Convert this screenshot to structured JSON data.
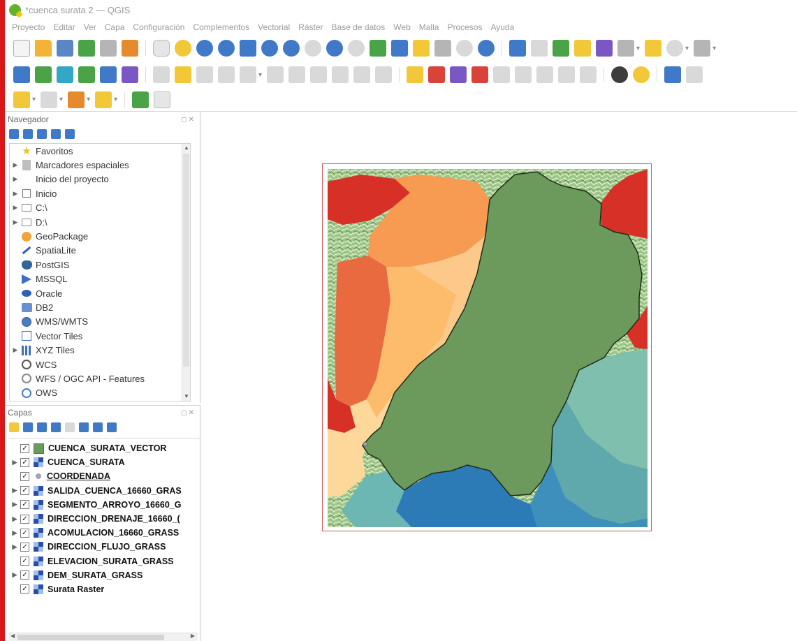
{
  "window": {
    "title": "*cuenca surata 2 — QGIS"
  },
  "menu": [
    "Proyecto",
    "Editar",
    "Ver",
    "Capa",
    "Configuración",
    "Complementos",
    "Vectorial",
    "Ráster",
    "Base de datos",
    "Web",
    "Malla",
    "Procesos",
    "Ayuda"
  ],
  "browser": {
    "title": "Navegador",
    "items": [
      {
        "label": "Favoritos",
        "icon": "star-icon",
        "expandable": false
      },
      {
        "label": "Marcadores espaciales",
        "icon": "bookmark-icon",
        "expandable": true
      },
      {
        "label": "Inicio del proyecto",
        "icon": "project-home-icon",
        "expandable": true
      },
      {
        "label": "Inicio",
        "icon": "home-folder-icon",
        "expandable": true
      },
      {
        "label": "C:\\",
        "icon": "drive-icon",
        "expandable": true
      },
      {
        "label": "D:\\",
        "icon": "drive-icon",
        "expandable": true
      },
      {
        "label": "GeoPackage",
        "icon": "geopackage-icon",
        "expandable": false
      },
      {
        "label": "SpatiaLite",
        "icon": "spatialite-icon",
        "expandable": false
      },
      {
        "label": "PostGIS",
        "icon": "postgis-icon",
        "expandable": false
      },
      {
        "label": "MSSQL",
        "icon": "mssql-icon",
        "expandable": false
      },
      {
        "label": "Oracle",
        "icon": "oracle-icon",
        "expandable": false
      },
      {
        "label": "DB2",
        "icon": "db2-icon",
        "expandable": false
      },
      {
        "label": "WMS/WMTS",
        "icon": "wms-icon",
        "expandable": false
      },
      {
        "label": "Vector Tiles",
        "icon": "vector-tiles-icon",
        "expandable": false
      },
      {
        "label": "XYZ Tiles",
        "icon": "xyz-tiles-icon",
        "expandable": true
      },
      {
        "label": "WCS",
        "icon": "wcs-icon",
        "expandable": false
      },
      {
        "label": "WFS / OGC API - Features",
        "icon": "wfs-icon",
        "expandable": false
      },
      {
        "label": "OWS",
        "icon": "ows-icon",
        "expandable": false
      }
    ]
  },
  "layers": {
    "title": "Capas",
    "items": [
      {
        "name": "CUENCA_SURATA_VECTOR",
        "type": "polygon",
        "checked": true,
        "expandable": false
      },
      {
        "name": "CUENCA_SURATA",
        "type": "raster",
        "checked": true,
        "expandable": true
      },
      {
        "name": "COORDENADA",
        "type": "point",
        "checked": true,
        "expandable": false,
        "underlined": true
      },
      {
        "name": "SALIDA_CUENCA_16660_GRAS",
        "type": "raster",
        "checked": true,
        "expandable": true
      },
      {
        "name": "SEGMENTO_ARROYO_16660_G",
        "type": "raster",
        "checked": true,
        "expandable": true
      },
      {
        "name": "DIRECCION_DRENAJE_16660_(",
        "type": "raster",
        "checked": true,
        "expandable": true
      },
      {
        "name": "ACOMULACION_16660_GRASS",
        "type": "raster",
        "checked": true,
        "expandable": true
      },
      {
        "name": "DIRECCION_FLUJO_GRASS",
        "type": "raster",
        "checked": true,
        "expandable": true
      },
      {
        "name": "ELEVACION_SURATA_GRASS",
        "type": "raster",
        "checked": true,
        "expandable": false
      },
      {
        "name": "DEM_SURATA_GRASS",
        "type": "raster",
        "checked": true,
        "expandable": true
      },
      {
        "name": "Surata Raster",
        "type": "raster",
        "checked": true,
        "expandable": false
      }
    ]
  },
  "colors": {
    "accent_red": "#d81818",
    "watershed_fill": "#6b9a5c",
    "subbasin_red": "#d73027",
    "subbasin_orange": "#fdae61",
    "subbasin_peach": "#fee08b",
    "subbasin_teal": "#66b0a8",
    "subbasin_blue": "#2c7bb6",
    "terrain_green": "#8bb87a"
  }
}
